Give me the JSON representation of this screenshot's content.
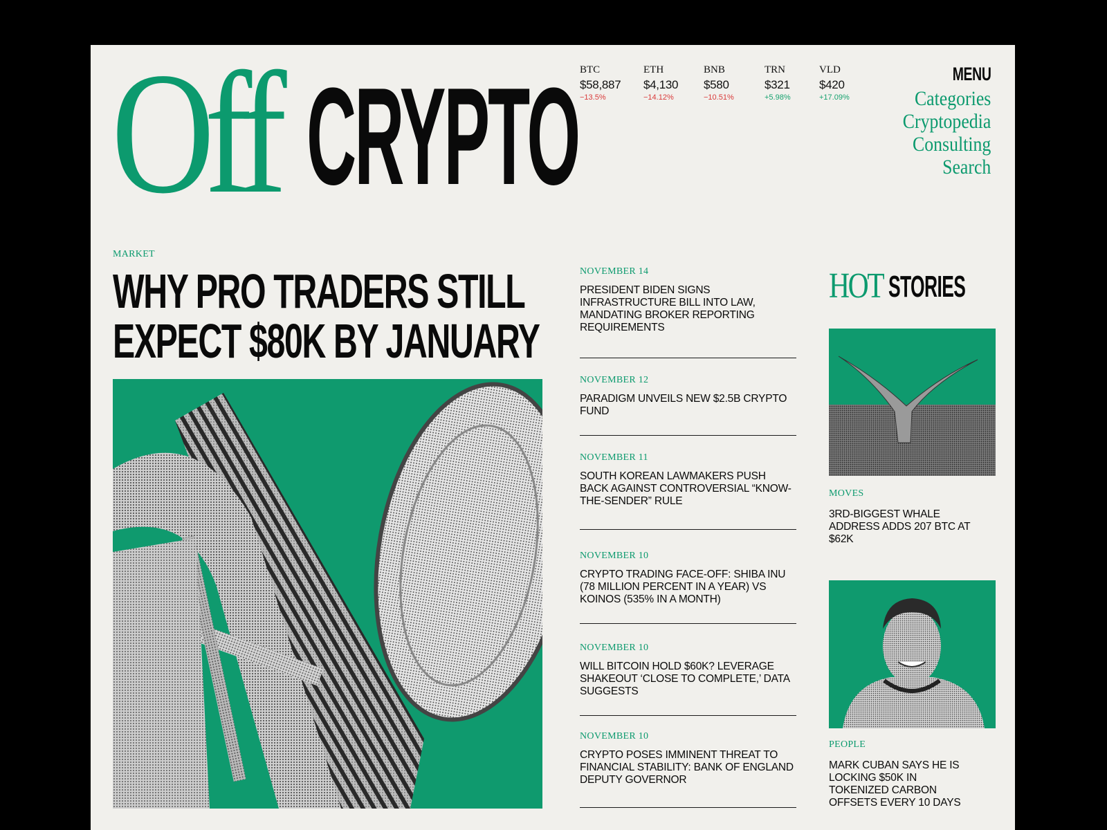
{
  "brand": {
    "off": "Off",
    "crypto": "CRYPTO"
  },
  "ticker": [
    {
      "symbol": "BTC",
      "price": "$58,887",
      "change": "−13.5%",
      "direction": "down"
    },
    {
      "symbol": "ETH",
      "price": "$4,130",
      "change": "−14.12%",
      "direction": "down"
    },
    {
      "symbol": "BNB",
      "price": "$580",
      "change": "−10.51%",
      "direction": "down"
    },
    {
      "symbol": "TRN",
      "price": "$321",
      "change": "+5.98%",
      "direction": "up"
    },
    {
      "symbol": "VLD",
      "price": "$420",
      "change": "+17.09%",
      "direction": "up"
    }
  ],
  "menu": {
    "title": "MENU",
    "items": [
      "Categories",
      "Cryptopedia",
      "Consulting",
      "Search"
    ]
  },
  "feature": {
    "category": "MARKET",
    "headline": "WHY PRO TRADERS STILL EXPECT $80K BY JANUARY",
    "image_icon": "bitcoin-coin-and-gears-image"
  },
  "news": [
    {
      "date": "NOVEMBER 14",
      "title": "PRESIDENT BIDEN SIGNS INFRASTRUCTURE BILL INTO LAW, MANDATING BROKER REPORTING REQUIREMENTS"
    },
    {
      "date": "NOVEMBER 12",
      "title": "PARADIGM UNVEILS NEW $2.5B CRYPTO FUND"
    },
    {
      "date": "NOVEMBER 11",
      "title": "SOUTH KOREAN LAWMAKERS PUSH BACK AGAINST CONTROVERSIAL “KNOW-THE-SENDER” RULE"
    },
    {
      "date": "NOVEMBER 10",
      "title": "CRYPTO TRADING FACE-OFF: SHIBA INU (78 MILLION PERCENT IN A YEAR) VS KOINOS (535% IN A MONTH)"
    },
    {
      "date": "NOVEMBER 10",
      "title": "WILL BITCOIN HOLD $60K? LEVERAGE SHAKEOUT ‘CLOSE TO COMPLETE,’ DATA SUGGESTS"
    },
    {
      "date": "NOVEMBER 10",
      "title": "CRYPTO POSES IMMINENT THREAT TO FINANCIAL STABILITY: BANK OF ENGLAND DEPUTY GOVERNOR"
    }
  ],
  "hot_stories": {
    "hot": "HOT",
    "stories": "STORIES",
    "items": [
      {
        "category": "MOVES",
        "title": "3RD-BIGGEST WHALE ADDRESS ADDS 207 BTC AT $62K",
        "image_icon": "whale-tail-image"
      },
      {
        "category": "PEOPLE",
        "title": "MARK CUBAN SAYS HE IS LOCKING $50K IN TOKENIZED CARBON OFFSETS EVERY 10 DAYS",
        "image_icon": "portrait-image"
      }
    ]
  },
  "colors": {
    "accent": "#0c9a6e",
    "paper": "#f1f0ec",
    "ink": "#0a0a0a",
    "negative": "#d93a3a",
    "positive": "#17a26f"
  }
}
